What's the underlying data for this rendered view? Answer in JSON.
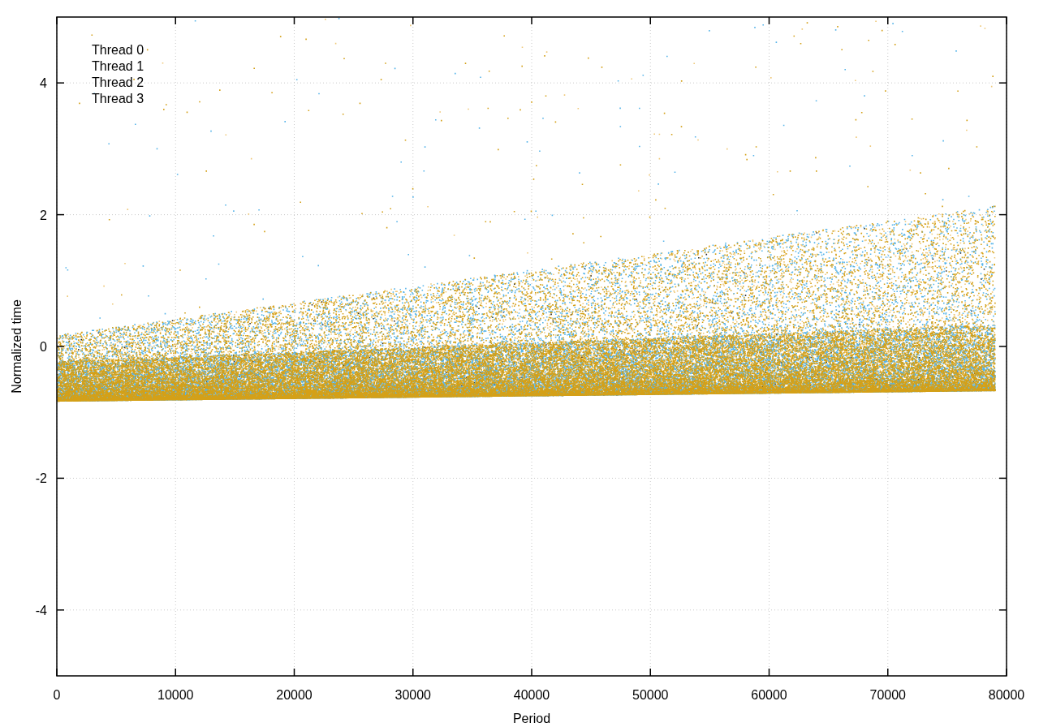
{
  "plot": {
    "x_axis": {
      "title": "Period",
      "tick_labels": [
        "0",
        "10000",
        "20000",
        "30000",
        "40000",
        "50000",
        "60000",
        "70000",
        "80000"
      ]
    },
    "y_axis": {
      "title": "Normalized time",
      "tick_labels": [
        "4",
        "2",
        "0",
        "-2",
        "-4"
      ]
    },
    "legend": [
      {
        "name": "Thread 0"
      },
      {
        "name": "Thread 1"
      },
      {
        "name": "Thread 2"
      },
      {
        "name": "Thread 3"
      }
    ]
  }
}
